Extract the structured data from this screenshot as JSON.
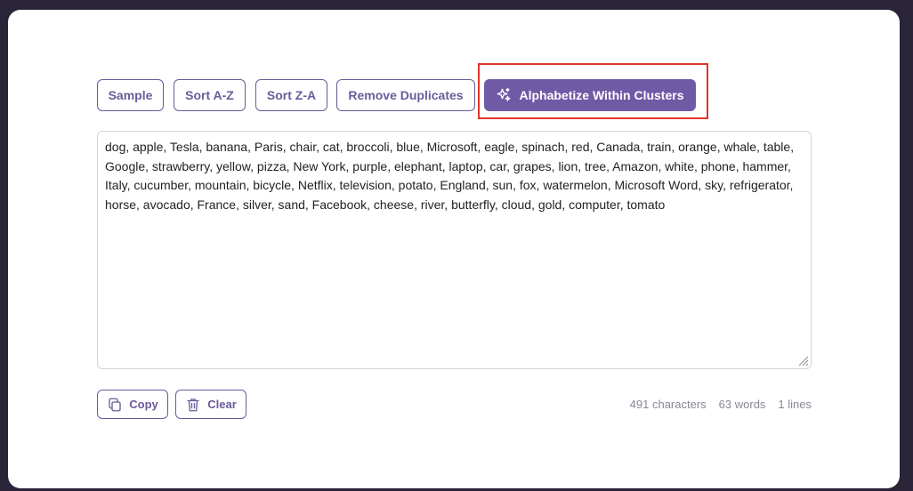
{
  "toolbar": {
    "sample_label": "Sample",
    "sort_az_label": "Sort A-Z",
    "sort_za_label": "Sort Z-A",
    "remove_duplicates_label": "Remove Duplicates",
    "alphabetize_clusters_label": "Alphabetize Within Clusters",
    "alphabetize_icon": "sparkles-icon"
  },
  "editor": {
    "text": "dog, apple, Tesla, banana, Paris, chair, cat, broccoli, blue, Microsoft, eagle, spinach, red, Canada, train, orange, whale, table, Google, strawberry, yellow, pizza, New York, purple, elephant, laptop, car, grapes, lion, tree, Amazon, white, phone, hammer, Italy, cucumber, mountain, bicycle, Netflix, television, potato, England, sun, fox, watermelon, Microsoft Word, sky, refrigerator, horse, avocado, France, silver, sand, Facebook, cheese, river, butterfly, cloud, gold, computer, tomato"
  },
  "actions": {
    "copy_label": "Copy",
    "copy_icon": "copy-icon",
    "clear_label": "Clear",
    "clear_icon": "trash-icon"
  },
  "stats": {
    "characters": "491 characters",
    "words": "63 words",
    "lines": "1 lines"
  },
  "colors": {
    "accent": "#6f5aa6",
    "highlight": "#e0352b",
    "background": "#2a2438"
  }
}
